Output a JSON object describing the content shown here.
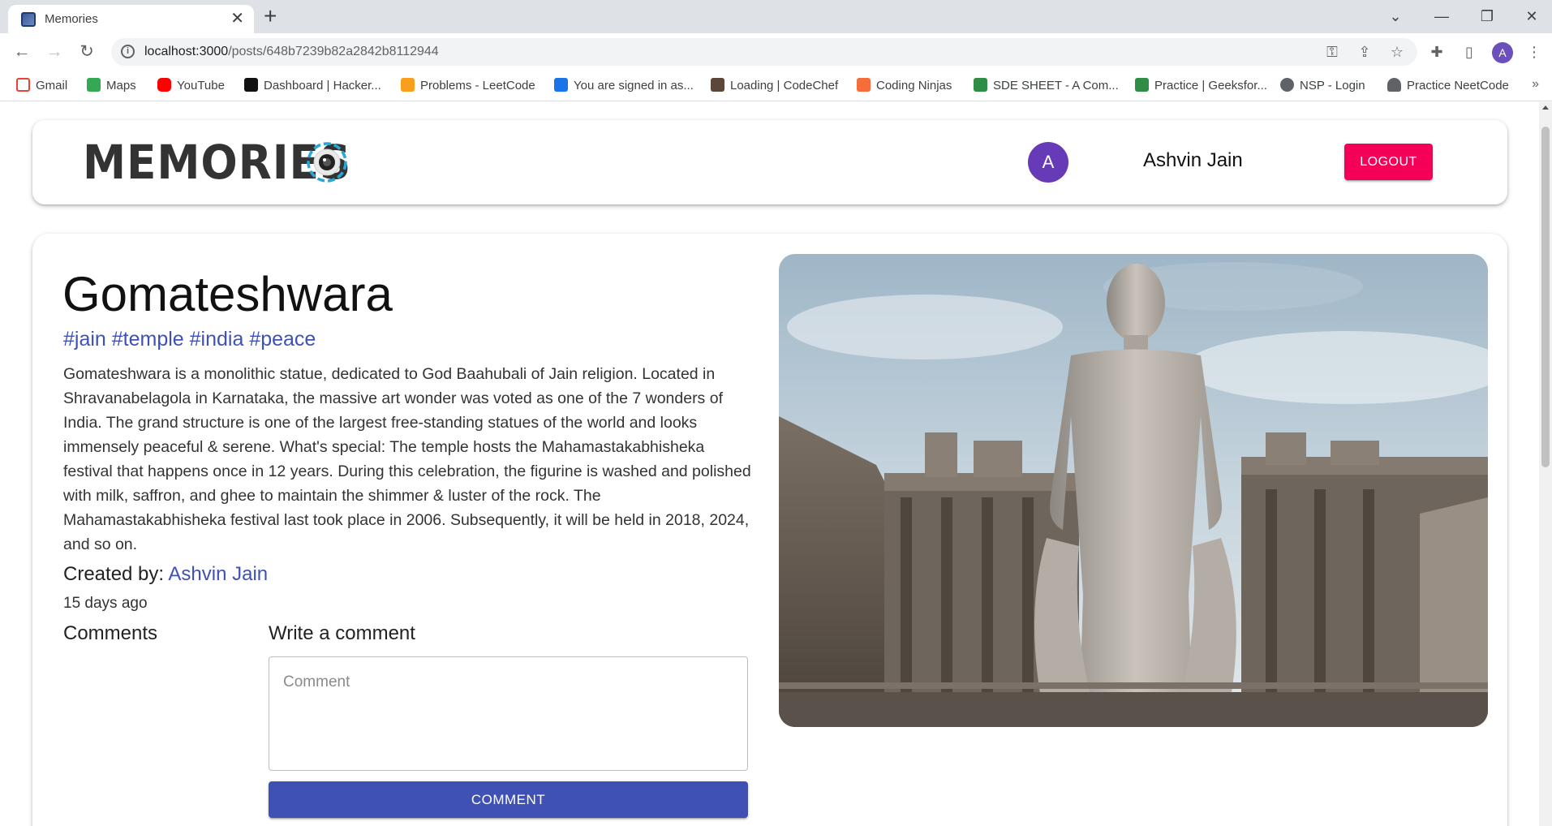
{
  "browser": {
    "tab_title": "Memories",
    "url_host": "localhost:3000",
    "url_path": "/posts/648b7239b82a2842b8112944",
    "profile_initial": "A",
    "bookmarks": [
      {
        "label": "Gmail",
        "icon": "gmail-icon",
        "color": "#ea4335"
      },
      {
        "label": "Maps",
        "icon": "maps-icon",
        "color": "#34a853"
      },
      {
        "label": "YouTube",
        "icon": "youtube-icon",
        "color": "#ff0000"
      },
      {
        "label": "Dashboard | Hacker...",
        "icon": "hackerrank-icon",
        "color": "#111111"
      },
      {
        "label": "Problems - LeetCode",
        "icon": "leetcode-icon",
        "color": "#f89f1b"
      },
      {
        "label": "You are signed in as...",
        "icon": "s-icon",
        "color": "#1a73e8"
      },
      {
        "label": "Loading | CodeChef",
        "icon": "codechef-icon",
        "color": "#5b4638"
      },
      {
        "label": "Coding Ninjas",
        "icon": "codingninjas-icon",
        "color": "#f66c3b"
      },
      {
        "label": "SDE SHEET - A Com...",
        "icon": "gfg-icon",
        "color": "#2f8d46"
      },
      {
        "label": "Practice | Geeksfor...",
        "icon": "gfg-icon",
        "color": "#2f8d46"
      },
      {
        "label": "NSP - Login",
        "icon": "globe-icon",
        "color": "#5f6368"
      },
      {
        "label": "Practice NeetCode",
        "icon": "neetcode-icon",
        "color": "#5f6368"
      }
    ]
  },
  "appbar": {
    "brand": "MEMORIES",
    "user_initial": "A",
    "user_name": "Ashvin Jain",
    "logout_label": "LOGOUT"
  },
  "post": {
    "title": "Gomateshwara",
    "tags": "#jain #temple #india #peace",
    "message": "Gomateshwara is a monolithic statue, dedicated to God Baahubali of Jain religion. Located in Shravanabelagola in Karnataka, the massive art wonder was voted as one of the 7 wonders of India. The grand structure is one of the largest free-standing statues of the world and looks immensely peaceful & serene. What's special: The temple hosts the Mahamastakabhisheka festival that happens once in 12 years. During this celebration, the figurine is washed and polished with milk, saffron, and ghee to maintain the shimmer & luster of the rock. The Mahamastakabhisheka festival last took place in 2006. Subsequently, it will be held in 2018, 2024, and so on.",
    "created_by_label": "Created by:",
    "author": "Ashvin Jain",
    "time_ago": "15 days ago",
    "image_alt": "Gomateshwara statue at Shravanabelagola"
  },
  "comments": {
    "heading": "Comments",
    "write_heading": "Write a comment",
    "placeholder": "Comment",
    "value": "",
    "submit_label": "COMMENT"
  },
  "colors": {
    "primary": "#3f51b5",
    "secondary": "#f50057",
    "avatar": "#673ab7"
  }
}
